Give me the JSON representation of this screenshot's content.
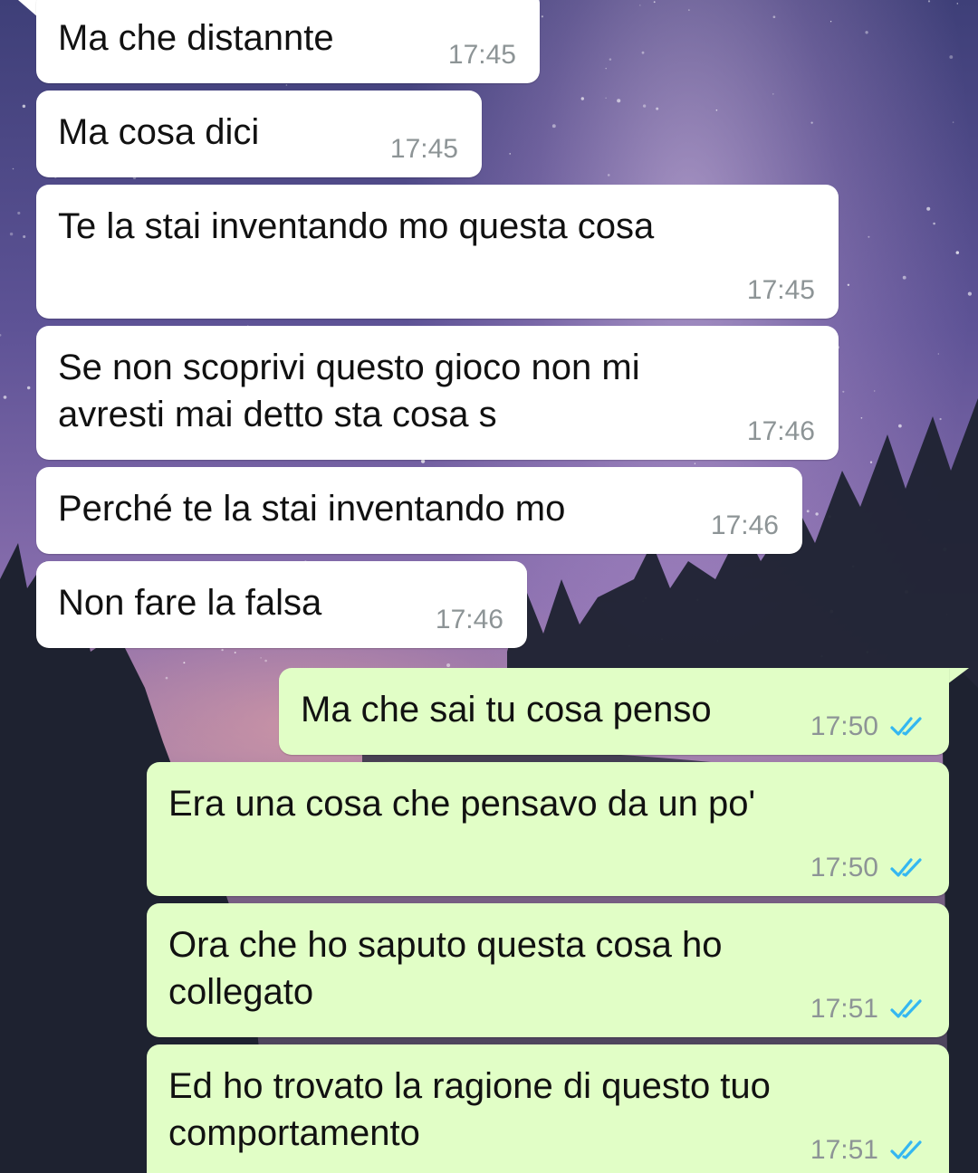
{
  "colors": {
    "incoming_bubble": "#ffffff",
    "outgoing_bubble": "#e1fec6",
    "timestamp": "#8d9496",
    "read_ticks": "#34b7f1"
  },
  "icons": {
    "read_receipt": "double-check-icon"
  },
  "messages": [
    {
      "direction": "incoming",
      "text": "Ma che distannte",
      "time": "17:45"
    },
    {
      "direction": "incoming",
      "text": "Ma cosa dici",
      "time": "17:45"
    },
    {
      "direction": "incoming",
      "text": "Te la stai inventando mo questa cosa",
      "time": "17:45"
    },
    {
      "direction": "incoming",
      "text": "Se non scoprivi questo gioco non mi\navresti mai detto sta cosa s",
      "time": "17:46"
    },
    {
      "direction": "incoming",
      "text": "Perché te la stai inventando mo",
      "time": "17:46"
    },
    {
      "direction": "incoming",
      "text": "Non fare la falsa",
      "time": "17:46"
    },
    {
      "direction": "outgoing",
      "text": "Ma che sai tu cosa penso",
      "time": "17:50",
      "status": "read"
    },
    {
      "direction": "outgoing",
      "text": "Era una cosa che pensavo da un po'",
      "time": "17:50",
      "status": "read"
    },
    {
      "direction": "outgoing",
      "text": "Ora che ho saputo questa cosa ho\ncollegato",
      "time": "17:51",
      "status": "read"
    },
    {
      "direction": "outgoing",
      "text": "Ed ho trovato la ragione di questo tuo\ncomportamento",
      "time": "17:51",
      "status": "read"
    }
  ]
}
